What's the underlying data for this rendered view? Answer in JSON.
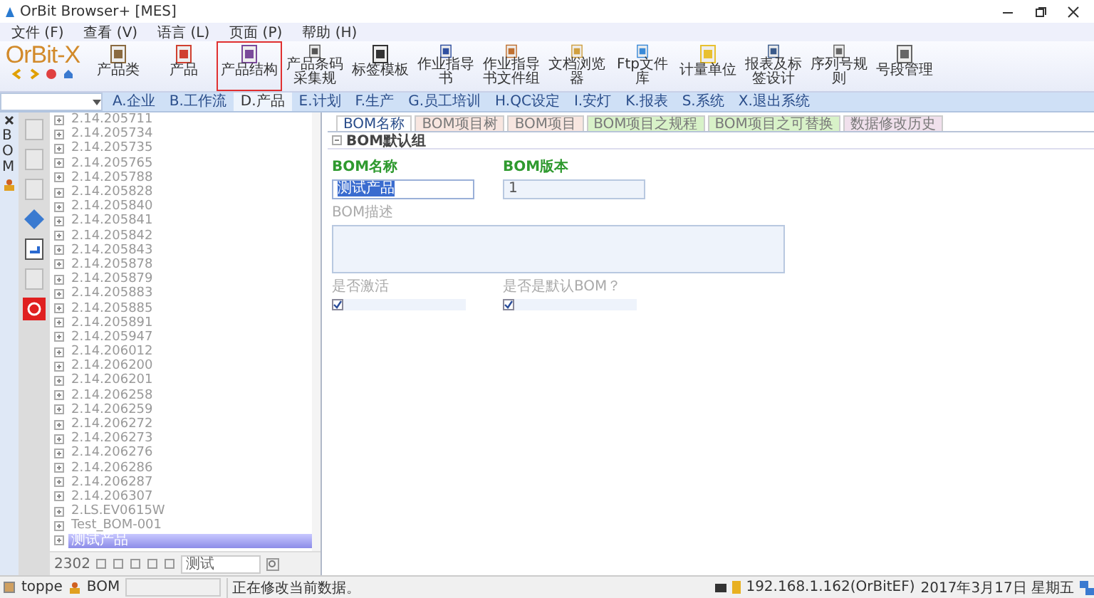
{
  "window": {
    "title": "OrBit Browser+ [MES]"
  },
  "menu": [
    "文件 (F)",
    "查看 (V)",
    "语言 (L)",
    "页面 (P)",
    "帮助 (H)"
  ],
  "logo": "OrBit-X",
  "ribbon": [
    {
      "label": "产品类",
      "selected": false
    },
    {
      "label": "产品",
      "selected": false
    },
    {
      "label": "产品结构",
      "selected": true
    },
    {
      "label": "产品条码采集规",
      "selected": false
    },
    {
      "label": "标签模板",
      "selected": false
    },
    {
      "label": "作业指导书",
      "selected": false
    },
    {
      "label": "作业指导书文件组",
      "selected": false
    },
    {
      "label": "文档浏览器",
      "selected": false
    },
    {
      "label": "Ftp文件库",
      "selected": false
    },
    {
      "label": "计量单位",
      "selected": false
    },
    {
      "label": "报表及标签设计",
      "selected": false
    },
    {
      "label": "序列号规则",
      "selected": false
    },
    {
      "label": "号段管理",
      "selected": false
    }
  ],
  "modules": [
    {
      "label": "A.企业",
      "selected": false
    },
    {
      "label": "B.工作流",
      "selected": false
    },
    {
      "label": "D.产品",
      "selected": true
    },
    {
      "label": "E.计划",
      "selected": false
    },
    {
      "label": "F.生产",
      "selected": false
    },
    {
      "label": "G.员工培训",
      "selected": false
    },
    {
      "label": "H.QC设定",
      "selected": false
    },
    {
      "label": "I.安灯",
      "selected": false
    },
    {
      "label": "K.报表",
      "selected": false
    },
    {
      "label": "S.系统",
      "selected": false
    },
    {
      "label": "X.退出系统",
      "selected": false
    }
  ],
  "side_tab": {
    "label": "BOM"
  },
  "tree": [
    {
      "label": "2.14.205711",
      "selected": false
    },
    {
      "label": "2.14.205734",
      "selected": false
    },
    {
      "label": "2.14.205735",
      "selected": false
    },
    {
      "label": "2.14.205765",
      "selected": false
    },
    {
      "label": "2.14.205788",
      "selected": false
    },
    {
      "label": "2.14.205828",
      "selected": false
    },
    {
      "label": "2.14.205840",
      "selected": false
    },
    {
      "label": "2.14.205841",
      "selected": false
    },
    {
      "label": "2.14.205842",
      "selected": false
    },
    {
      "label": "2.14.205843",
      "selected": false
    },
    {
      "label": "2.14.205878",
      "selected": false
    },
    {
      "label": "2.14.205879",
      "selected": false
    },
    {
      "label": "2.14.205883",
      "selected": false
    },
    {
      "label": "2.14.205885",
      "selected": false
    },
    {
      "label": "2.14.205891",
      "selected": false
    },
    {
      "label": "2.14.205947",
      "selected": false
    },
    {
      "label": "2.14.206012",
      "selected": false
    },
    {
      "label": "2.14.206200",
      "selected": false
    },
    {
      "label": "2.14.206201",
      "selected": false
    },
    {
      "label": "2.14.206258",
      "selected": false
    },
    {
      "label": "2.14.206259",
      "selected": false
    },
    {
      "label": "2.14.206272",
      "selected": false
    },
    {
      "label": "2.14.206273",
      "selected": false
    },
    {
      "label": "2.14.206276",
      "selected": false
    },
    {
      "label": "2.14.206286",
      "selected": false
    },
    {
      "label": "2.14.206287",
      "selected": false
    },
    {
      "label": "2.14.206307",
      "selected": false
    },
    {
      "label": "2.LS.EV0615W",
      "selected": false
    },
    {
      "label": "Test_BOM-001",
      "selected": false
    },
    {
      "label": "测试产品",
      "selected": true
    }
  ],
  "tree_footer": {
    "count": "2302",
    "search": "测试"
  },
  "tabs": [
    {
      "label": "BOM名称",
      "selected": true,
      "color": "#ffffff"
    },
    {
      "label": "BOM项目树",
      "selected": false,
      "color": "#f8e6e0"
    },
    {
      "label": "BOM项目",
      "selected": false,
      "color": "#f8e6e0"
    },
    {
      "label": "BOM项目之规程",
      "selected": false,
      "color": "#d8f2c8"
    },
    {
      "label": "BOM项目之可替换",
      "selected": false,
      "color": "#d8f2c8"
    },
    {
      "label": "数据修改历史",
      "selected": false,
      "color": "#f0e0ec"
    }
  ],
  "group": {
    "title": "BOM默认组"
  },
  "fields": [
    {
      "kind": "text",
      "label": "BOM名称",
      "required": true,
      "value": "测试产品",
      "text_selected": true
    },
    {
      "kind": "text",
      "label": "BOM版本",
      "required": true,
      "value": "1",
      "text_selected": false
    },
    {
      "kind": "textarea",
      "label": "BOM描述",
      "required": false
    },
    {
      "kind": "checkbox",
      "label": "是否激活",
      "required": false,
      "checked": true
    },
    {
      "kind": "checkbox",
      "label": "是否是默认BOM？",
      "required": false,
      "checked": true
    }
  ],
  "status_bar": {
    "user": "toppe",
    "module": "BOM",
    "message": "正在修改当前数据。",
    "server": "192.168.1.162(OrBitEF)",
    "date": "2017年3月17日 星期五"
  }
}
